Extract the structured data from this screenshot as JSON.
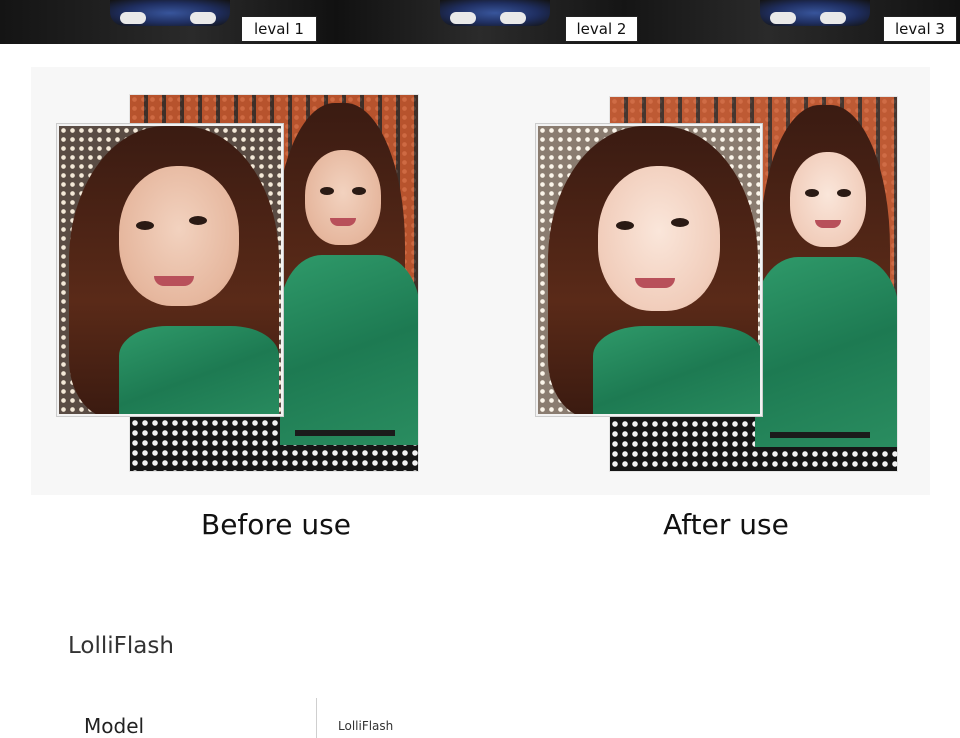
{
  "levels": [
    "leval 1",
    "leval 2",
    "leval 3"
  ],
  "comparison": {
    "before_caption": "Before use",
    "after_caption": "After use"
  },
  "product": {
    "title": "LolliFlash",
    "specs": [
      {
        "label": "Model",
        "value": "LolliFlash"
      }
    ]
  }
}
